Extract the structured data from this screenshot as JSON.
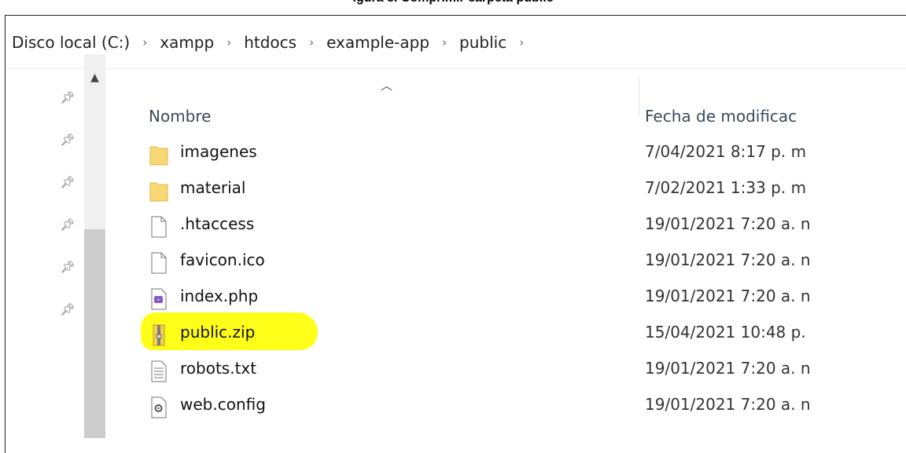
{
  "caption": "igura 8. Comprimir carpeta public",
  "breadcrumb": [
    {
      "label": "Disco local (C:)"
    },
    {
      "label": "xampp"
    },
    {
      "label": "htdocs"
    },
    {
      "label": "example-app"
    },
    {
      "label": "public"
    }
  ],
  "columns": {
    "name": "Nombre",
    "date": "Fecha de modificac"
  },
  "files": [
    {
      "name": "imagenes",
      "date": "7/04/2021 8:17 p. m",
      "type": "folder"
    },
    {
      "name": "material",
      "date": "7/02/2021 1:33 p. m",
      "type": "folder"
    },
    {
      "name": ".htaccess",
      "date": "19/01/2021 7:20 a. n",
      "type": "file"
    },
    {
      "name": "favicon.ico",
      "date": "19/01/2021 7:20 a. n",
      "type": "file"
    },
    {
      "name": "index.php",
      "date": "19/01/2021 7:20 a. n",
      "type": "php"
    },
    {
      "name": "public.zip",
      "date": "15/04/2021 10:48 p.",
      "type": "zip",
      "highlighted": true
    },
    {
      "name": "robots.txt",
      "date": "19/01/2021 7:20 a. n",
      "type": "text"
    },
    {
      "name": "web.config",
      "date": "19/01/2021 7:20 a. n",
      "type": "config"
    }
  ],
  "colors": {
    "highlight": "#ffff00",
    "folder": "#f8d775"
  }
}
